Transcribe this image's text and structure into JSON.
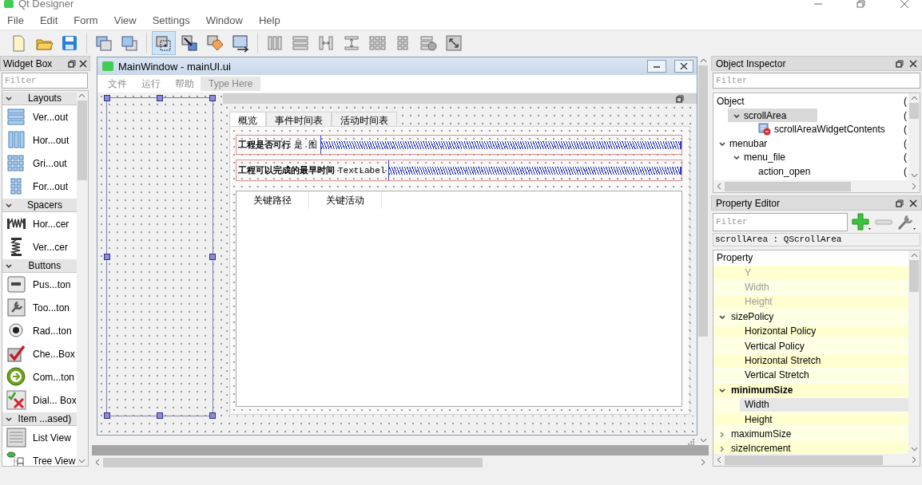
{
  "app": {
    "title": "Qt Designer"
  },
  "menu": [
    "File",
    "Edit",
    "Form",
    "View",
    "Settings",
    "Window",
    "Help"
  ],
  "toolbar": [
    {
      "kind": "new",
      "selected": false
    },
    {
      "kind": "open",
      "selected": false
    },
    {
      "kind": "save",
      "selected": false
    },
    {
      "kind": "sep"
    },
    {
      "kind": "back",
      "selected": false
    },
    {
      "kind": "front",
      "selected": false
    },
    {
      "kind": "sep"
    },
    {
      "kind": "edit-widgets",
      "selected": true
    },
    {
      "kind": "edit-signals",
      "selected": false
    },
    {
      "kind": "edit-buddies",
      "selected": false
    },
    {
      "kind": "edit-taborder",
      "selected": false
    },
    {
      "kind": "sep"
    },
    {
      "kind": "hlayout",
      "selected": false
    },
    {
      "kind": "vlayout",
      "selected": false
    },
    {
      "kind": "hsplit",
      "selected": false
    },
    {
      "kind": "vsplit",
      "selected": false
    },
    {
      "kind": "grid",
      "selected": false
    },
    {
      "kind": "form",
      "selected": false
    },
    {
      "kind": "break",
      "selected": false
    },
    {
      "kind": "adjust",
      "selected": false
    }
  ],
  "widget_box": {
    "title": "Widget Box",
    "filter_placeholder": "Filter",
    "categories": [
      {
        "name": "Layouts",
        "expanded": true,
        "items": [
          {
            "label": "Ver...out",
            "kind": "vlayout"
          },
          {
            "label": "Hor...out",
            "kind": "hlayout"
          },
          {
            "label": "Gri...out",
            "kind": "grid"
          },
          {
            "label": "For...out",
            "kind": "form"
          }
        ]
      },
      {
        "name": "Spacers",
        "expanded": true,
        "items": [
          {
            "label": "Hor...cer",
            "kind": "hspacer"
          },
          {
            "label": "Ver...cer",
            "kind": "vspacer"
          }
        ]
      },
      {
        "name": "Buttons",
        "expanded": true,
        "items": [
          {
            "label": "Pus...ton",
            "kind": "push"
          },
          {
            "label": "Too...ton",
            "kind": "tool"
          },
          {
            "label": "Rad...ton",
            "kind": "radio"
          },
          {
            "label": "Che...Box",
            "kind": "check"
          },
          {
            "label": "Com...ton",
            "kind": "command"
          },
          {
            "label": "Dial... Box",
            "kind": "dialog"
          }
        ]
      },
      {
        "name": "Item ...ased)",
        "expanded": true,
        "items": [
          {
            "label": "List View",
            "kind": "list"
          },
          {
            "label": "Tree View",
            "kind": "tree"
          }
        ]
      }
    ]
  },
  "form_window": {
    "title": "MainWindow - mainUI.ui",
    "menus": [
      "文件",
      "运行",
      "帮助"
    ],
    "type_here": "Type Here",
    "tabs": [
      {
        "label": "概览",
        "selected": true
      },
      {
        "label": "事件时间表",
        "selected": false
      },
      {
        "label": "活动时间表",
        "selected": false
      }
    ],
    "rows": [
      {
        "label": "工程是否可行",
        "value": "是 图"
      },
      {
        "label": "工程可以完成的最早时间",
        "value": "TextLabel"
      }
    ],
    "table_headers": [
      "关键路径",
      "关键活动"
    ]
  },
  "object_inspector": {
    "title": "Object Inspector",
    "filter_placeholder": "Filter",
    "header": "Object",
    "header_column_2": "(",
    "tree": [
      {
        "children": [
          {
            "name": "scrollArea",
            "column_2": "(",
            "icon": false,
            "expanded": true,
            "selected": true,
            "children": [
              {
                "name": "scrollAreaWidgetContents",
                "column_2": "(",
                "icon": true,
                "selected": false
              }
            ]
          }
        ]
      },
      {
        "name": "menubar",
        "column_2": "(",
        "icon": false,
        "expanded": true,
        "selected": false,
        "children": [
          {
            "name": "menu_file",
            "column_2": "(",
            "icon": false,
            "expanded": true,
            "selected": false,
            "children": [
              {
                "name": "action_open",
                "column_2": "(",
                "icon": false,
                "selected": false
              }
            ]
          }
        ]
      }
    ]
  },
  "property_editor": {
    "title": "Property Editor",
    "filter_placeholder": "Filter",
    "object": "scrollArea : QScrollArea",
    "header": "Property",
    "rows": [
      {
        "name": "Y",
        "kind": "sub",
        "disabled": true,
        "modified": false,
        "selected": false
      },
      {
        "name": "Width",
        "kind": "sub",
        "disabled": true,
        "modified": false,
        "selected": false
      },
      {
        "name": "Height",
        "kind": "sub",
        "disabled": true,
        "modified": false,
        "selected": false
      },
      {
        "name": "sizePolicy",
        "kind": "group",
        "expanded": true,
        "disabled": false,
        "modified": false,
        "selected": false
      },
      {
        "name": "Horizontal Policy",
        "kind": "sub",
        "disabled": false,
        "modified": false,
        "selected": false
      },
      {
        "name": "Vertical Policy",
        "kind": "sub",
        "disabled": false,
        "modified": false,
        "selected": false
      },
      {
        "name": "Horizontal Stretch",
        "kind": "sub",
        "disabled": false,
        "modified": false,
        "selected": false
      },
      {
        "name": "Vertical Stretch",
        "kind": "sub",
        "disabled": false,
        "modified": false,
        "selected": false
      },
      {
        "name": "minimumSize",
        "kind": "group",
        "expanded": true,
        "disabled": false,
        "modified": true,
        "selected": false
      },
      {
        "name": "Width",
        "kind": "sub",
        "disabled": false,
        "modified": false,
        "selected": true
      },
      {
        "name": "Height",
        "kind": "sub",
        "disabled": false,
        "modified": false,
        "selected": false
      },
      {
        "name": "maximumSize",
        "kind": "group",
        "expanded": false,
        "disabled": false,
        "modified": false,
        "selected": false
      },
      {
        "name": "sizeIncrement",
        "kind": "group",
        "expanded": false,
        "disabled": false,
        "modified": false,
        "selected": false
      }
    ]
  }
}
